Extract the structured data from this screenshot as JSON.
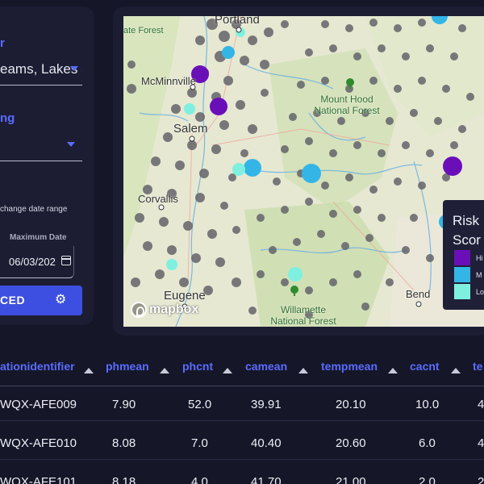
{
  "filters": {
    "layer_label": "r",
    "layer_value": "eams, Lakes 8",
    "second_label": "ng",
    "second_value": "",
    "date_hint": "change date range",
    "max_date_label": "Maximum Date",
    "max_date_value": "06/03/202",
    "advanced_button": "CED"
  },
  "map": {
    "places": [
      {
        "name": "Portland"
      },
      {
        "name": "McMinnville"
      },
      {
        "name": "Salem"
      },
      {
        "name": "Corvallis"
      },
      {
        "name": "Eugene"
      },
      {
        "name": "Bend"
      },
      {
        "name": "Mount Hood National Forest"
      },
      {
        "name": "Willamette National Forest"
      },
      {
        "name": "ate Forest"
      }
    ],
    "attribution": "mapbox",
    "legend": {
      "title_line1": "Risk",
      "title_line2": "Scor",
      "items": [
        {
          "label": "Hi",
          "color": "#6a0fb8"
        },
        {
          "label": "M",
          "color": "#33b5e6"
        },
        {
          "label": "Lo",
          "color": "#7ff0e0"
        }
      ]
    }
  },
  "table": {
    "columns": [
      "ationidentifier",
      "phmean",
      "phcnt",
      "camean",
      "tempmean",
      "cacnt",
      "te"
    ],
    "rows": [
      [
        "WQX-AFE009",
        "7.90",
        "52.0",
        "39.91",
        "20.10",
        "10.0",
        "4"
      ],
      [
        "WQX-AFE010",
        "8.08",
        "7.0",
        "40.40",
        "20.60",
        "6.0",
        "4"
      ],
      [
        "WQX-AFE101",
        "8.18",
        "4.0",
        "41.70",
        "21.00",
        "2.0",
        "2"
      ]
    ]
  },
  "colors": {
    "accent": "#5a6cff",
    "button": "#3d4fe0",
    "background": "#151628",
    "panel": "#1c1d33"
  }
}
